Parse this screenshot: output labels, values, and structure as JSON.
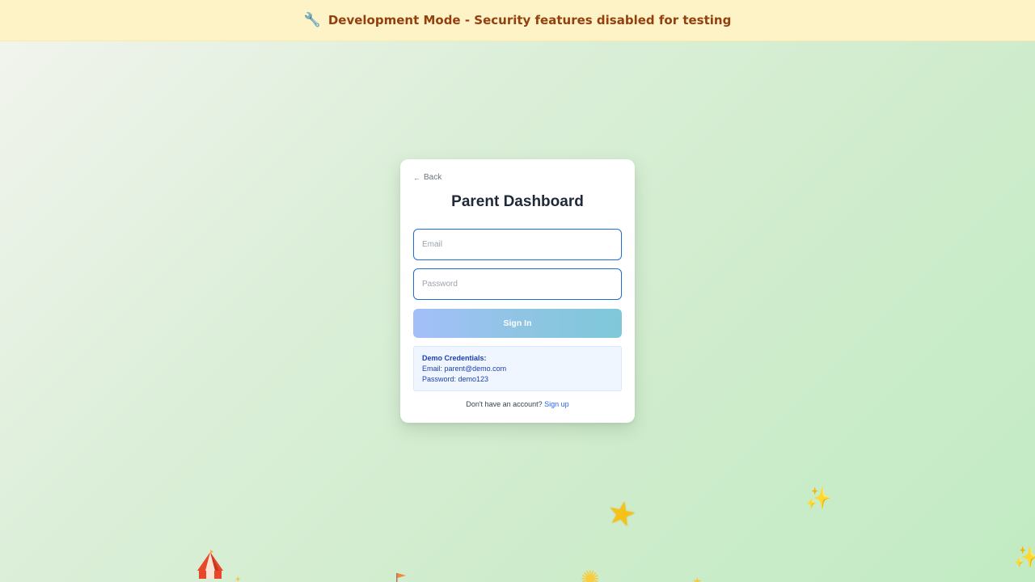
{
  "banner": {
    "icon": "wrench-icon",
    "text": "Development Mode - Security features disabled for testing"
  },
  "login": {
    "back_label": "Back",
    "title": "Parent Dashboard",
    "email_placeholder": "Email",
    "email_value": "",
    "password_placeholder": "Password",
    "password_value": "",
    "signin_label": "Sign In",
    "demo": {
      "heading": "Demo Credentials:",
      "email_line": "Email: parent@demo.com",
      "password_line": "Password: demo123"
    },
    "signup_prompt": "Don't have an account?",
    "signup_link": "Sign up"
  },
  "colors": {
    "banner_bg": "#fef3c7",
    "banner_text": "#92400e",
    "input_border": "#1d6fd1",
    "link": "#2563eb",
    "demo_bg": "#eff6ff"
  }
}
